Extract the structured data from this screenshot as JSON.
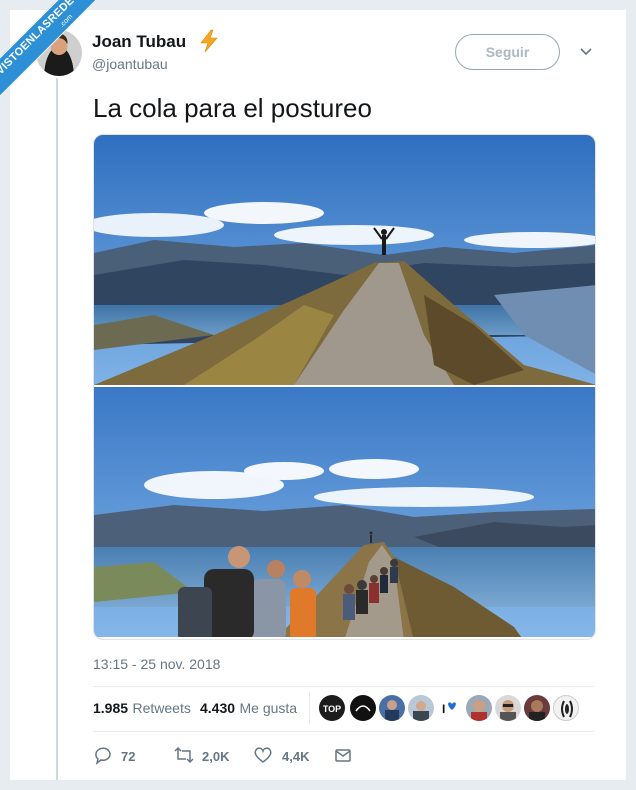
{
  "watermark": {
    "main": "VISTOENLASREDES",
    "sub": ".com"
  },
  "author": {
    "name": "Joan Tubau",
    "handle": "@joantubau",
    "emoji_icon": "lightning-bolt-icon",
    "avatar_alt": "Joan Tubau avatar"
  },
  "follow_button": {
    "label": "Seguir"
  },
  "menu_icon": "chevron-down-icon",
  "tweet": {
    "text": "La cola para el postureo",
    "timestamp": "13:15 - 25 nov. 2018"
  },
  "stats": {
    "retweets_count": "1.985",
    "retweets_label": "Retweets",
    "likes_count": "4.430",
    "likes_label": "Me gusta"
  },
  "likers_avatar_count": 9,
  "actions": {
    "reply": {
      "icon": "reply-icon",
      "count": "72"
    },
    "retweet": {
      "icon": "retweet-icon",
      "count": "2,0K"
    },
    "like": {
      "icon": "heart-icon",
      "count": "4,4K"
    },
    "message": {
      "icon": "envelope-icon"
    }
  },
  "colors": {
    "background": "#e6ecf0",
    "ribbon": "#2d8fd6",
    "muted_text": "#657786",
    "bolt": "#f5a623"
  }
}
